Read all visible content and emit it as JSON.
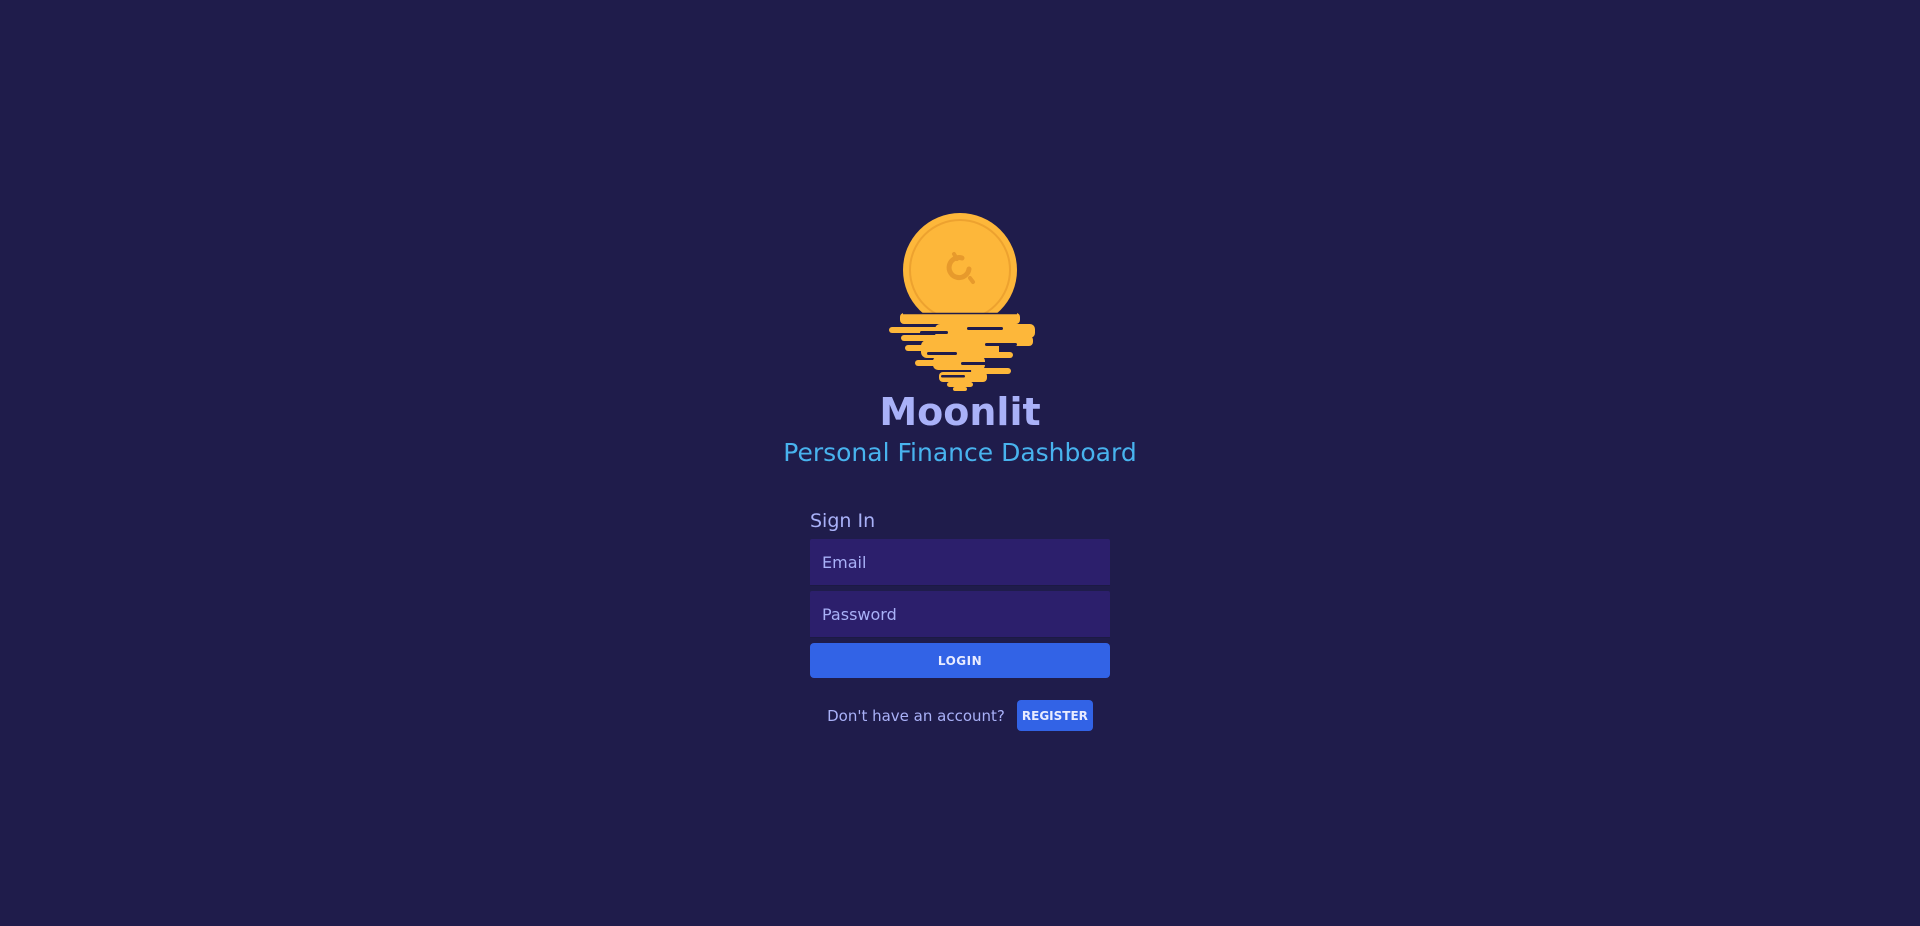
{
  "app": {
    "title": "Moonlit",
    "subtitle": "Personal Finance Dashboard",
    "logo_icon": "moon-coin-icon"
  },
  "colors": {
    "background": "#1f1c4b",
    "title": "#a9b1f8",
    "subtitle": "#48b3ee",
    "input_background": "#2c1f6c",
    "button": "#3263e6",
    "logo": "#fdb73a"
  },
  "sign_in": {
    "heading": "Sign In",
    "email_placeholder": "Email",
    "password_placeholder": "Password",
    "login_label": "LOGIN"
  },
  "register": {
    "prompt": "Don't have an account?",
    "button_label": "REGISTER"
  }
}
